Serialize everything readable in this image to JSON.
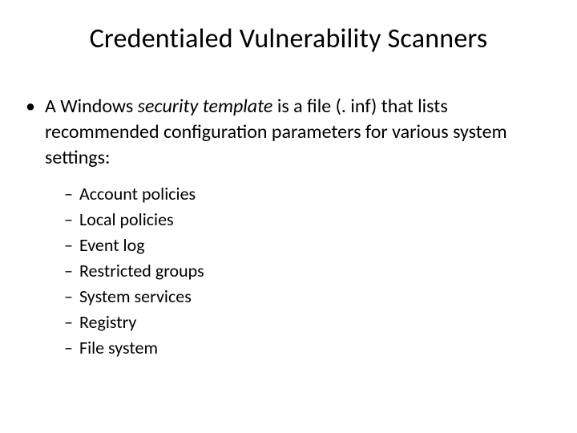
{
  "title": "Credentialed Vulnerability Scanners",
  "main_bullet": {
    "pre_italic": "A Windows ",
    "italic": "security template",
    "post_italic": " is a file (. inf) that lists recommended configuration parameters for various system settings:"
  },
  "sub_items": [
    "Account policies",
    "Local policies",
    "Event log",
    "Restricted groups",
    "System services",
    "Registry",
    "File system"
  ]
}
